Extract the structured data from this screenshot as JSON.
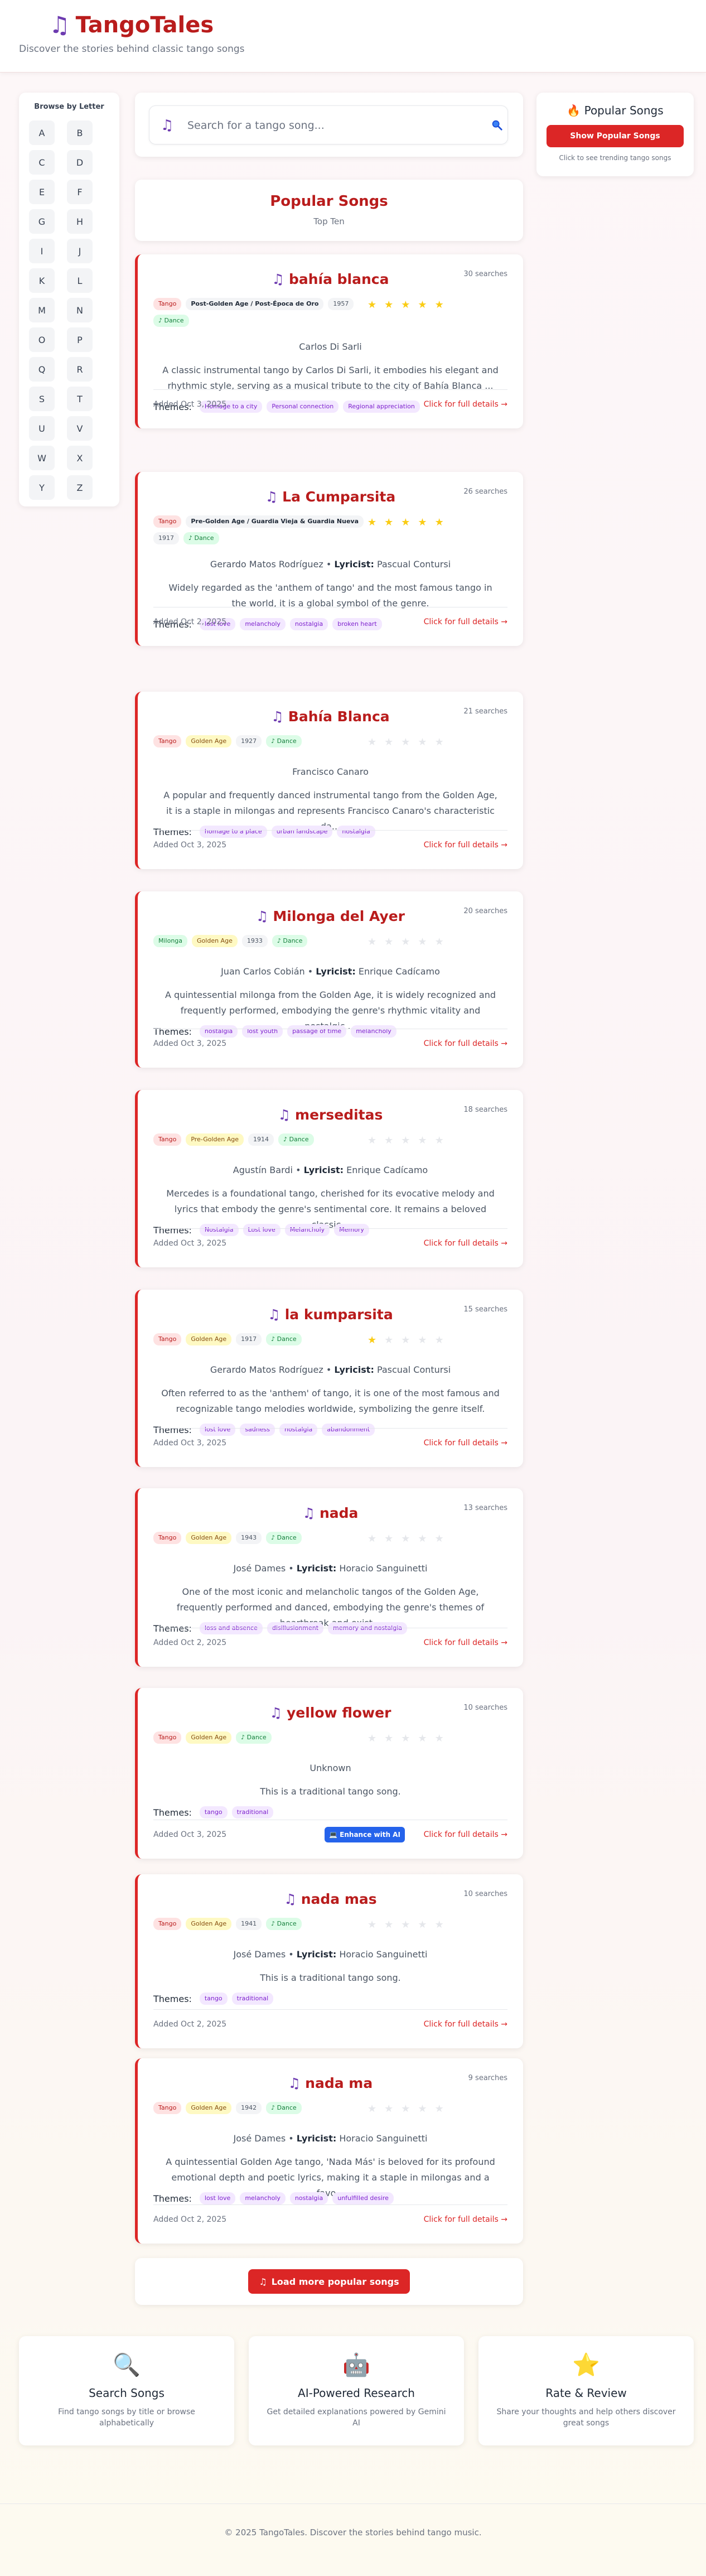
{
  "header": {
    "logo_icon": "music-note-icon",
    "app_name": "TangoTales",
    "tagline": "Discover the stories behind classic tango songs"
  },
  "browse": {
    "title": "Browse by Letter",
    "letters": [
      "A",
      "B",
      "C",
      "D",
      "E",
      "F",
      "G",
      "H",
      "I",
      "J",
      "K",
      "L",
      "M",
      "N",
      "O",
      "P",
      "Q",
      "R",
      "S",
      "T",
      "U",
      "V",
      "W",
      "X",
      "Y",
      "Z"
    ]
  },
  "search": {
    "placeholder": "Search for a tango song..."
  },
  "popular_panel": {
    "title": "Popular Songs",
    "button": "Show Popular Songs",
    "hint": "Click to see trending tango songs"
  },
  "popular_header": {
    "title": "Popular Songs",
    "subtitle": "Top Ten"
  },
  "labels": {
    "themes": "Themes:",
    "details": "Click for full details →",
    "lyricist": "Lyricist:",
    "enhance": "Enhance with AI"
  },
  "songs": [
    {
      "title": "bahía blanca",
      "searches": "30 searches",
      "tags": [
        "Tango",
        "Post-Golden Age / Post-Época de Oro",
        "1957",
        "♪ Dance"
      ],
      "rating": 5,
      "composer": "Carlos Di Sarli",
      "lyricist": "",
      "description": "A classic instrumental tango by Carlos Di Sarli, it embodies his elegant and rhythmic style, serving as a musical tribute to the city of Bahía Blanca ...",
      "themes": [
        "Homage to a city",
        "Personal connection",
        "Regional appreciation"
      ],
      "added": "Added Oct 3, 2025"
    },
    {
      "title": "La Cumparsita",
      "searches": "26 searches",
      "tags": [
        "Tango",
        "Pre-Golden Age / Guardia Vieja & Guardia Nueva",
        "1917",
        "♪ Dance"
      ],
      "rating": 5,
      "composer": "Gerardo Matos Rodríguez",
      "lyricist": "Pascual Contursi",
      "description": "Widely regarded as the 'anthem of tango' and the most famous tango in the world, it is a global symbol of the genre.",
      "themes": [
        "lost love",
        "melancholy",
        "nostalgia",
        "broken heart"
      ],
      "added": "Added Oct 2, 2025"
    },
    {
      "title": "Bahía Blanca",
      "searches": "21 searches",
      "tags": [
        "Tango",
        "Golden Age",
        "1927",
        "♪ Dance"
      ],
      "rating": 0,
      "composer": "Francisco Canaro",
      "lyricist": "",
      "description": "A popular and frequently danced instrumental tango from the Golden Age, it is a staple in milongas and represents Francisco Canaro's characteristic da...",
      "themes": [
        "homage to a place",
        "urban landscape",
        "nostalgia"
      ],
      "added": "Added Oct 3, 2025"
    },
    {
      "title": "Milonga del Ayer",
      "searches": "20 searches",
      "tags": [
        "Milonga",
        "Golden Age",
        "1933",
        "♪ Dance"
      ],
      "rating": 0,
      "composer": "Juan Carlos Cobián",
      "lyricist": "Enrique Cadícamo",
      "description": "A quintessential milonga from the Golden Age, it is widely recognized and frequently performed, embodying the genre's rhythmic vitality and nostalgic ...",
      "themes": [
        "nostalgia",
        "lost youth",
        "passage of time",
        "melancholy"
      ],
      "added": "Added Oct 3, 2025"
    },
    {
      "title": "merseditas",
      "searches": "18 searches",
      "tags": [
        "Tango",
        "Pre-Golden Age",
        "1914",
        "♪ Dance"
      ],
      "rating": 0,
      "composer": "Agustín Bardi",
      "lyricist": "Enrique Cadícamo",
      "description": "Mercedes is a foundational tango, cherished for its evocative melody and lyrics that embody the genre's sentimental core. It remains a beloved classic...",
      "themes": [
        "Nostalgia",
        "Lost love",
        "Melancholy",
        "Memory"
      ],
      "added": "Added Oct 3, 2025"
    },
    {
      "title": "la kumparsita",
      "searches": "15 searches",
      "tags": [
        "Tango",
        "Golden Age",
        "1917",
        "♪ Dance"
      ],
      "rating": 1,
      "composer": "Gerardo Matos Rodríguez",
      "lyricist": "Pascual Contursi",
      "description": "Often referred to as the 'anthem' of tango, it is one of the most famous and recognizable tango melodies worldwide, symbolizing the genre itself.",
      "themes": [
        "lost love",
        "sadness",
        "nostalgia",
        "abandonment"
      ],
      "added": "Added Oct 3, 2025"
    },
    {
      "title": "nada",
      "searches": "13 searches",
      "tags": [
        "Tango",
        "Golden Age",
        "1943",
        "♪ Dance"
      ],
      "rating": 0,
      "composer": "José Dames",
      "lyricist": "Horacio Sanguinetti",
      "description": "One of the most iconic and melancholic tangos of the Golden Age, frequently performed and danced, embodying the genre's themes of heartbreak and exist...",
      "themes": [
        "loss and absence",
        "disillusionment",
        "memory and nostalgia"
      ],
      "added": "Added Oct 2, 2025"
    },
    {
      "title": "yellow flower",
      "searches": "10 searches",
      "tags": [
        "Tango",
        "Golden Age",
        "♪ Dance"
      ],
      "rating": 0,
      "composer": "Unknown",
      "lyricist": "",
      "description": "This is a traditional tango song.",
      "themes": [
        "tango",
        "traditional"
      ],
      "added": "Added Oct 3, 2025",
      "enhance": true
    },
    {
      "title": "nada mas",
      "searches": "10 searches",
      "tags": [
        "Tango",
        "Golden Age",
        "1941",
        "♪ Dance"
      ],
      "rating": 0,
      "composer": "José Dames",
      "lyricist": "Horacio Sanguinetti",
      "description": "This is a traditional tango song.",
      "themes": [
        "tango",
        "traditional"
      ],
      "added": "Added Oct 2, 2025"
    },
    {
      "title": "nada ma",
      "searches": "9 searches",
      "tags": [
        "Tango",
        "Golden Age",
        "1942",
        "♪ Dance"
      ],
      "rating": 0,
      "composer": "José Dames",
      "lyricist": "Horacio Sanguinetti",
      "description": "A quintessential Golden Age tango, 'Nada Más' is beloved for its profound emotional depth and poetic lyrics, making it a staple in milongas and a favo...",
      "themes": [
        "lost love",
        "melancholy",
        "nostalgia",
        "unfulfilled desire"
      ],
      "added": "Added Oct 2, 2025"
    }
  ],
  "load_more": "Load more popular songs",
  "features": [
    {
      "icon": "magnifier-icon",
      "title": "Search Songs",
      "desc": "Find tango songs by title or browse alphabetically"
    },
    {
      "icon": "robot-icon",
      "title": "AI-Powered Research",
      "desc": "Get detailed explanations powered by Gemini AI"
    },
    {
      "icon": "star-icon",
      "title": "Rate & Review",
      "desc": "Share your thoughts and help others discover great songs"
    }
  ],
  "footer": "© 2025 TangoTales. Discover the stories behind tango music."
}
